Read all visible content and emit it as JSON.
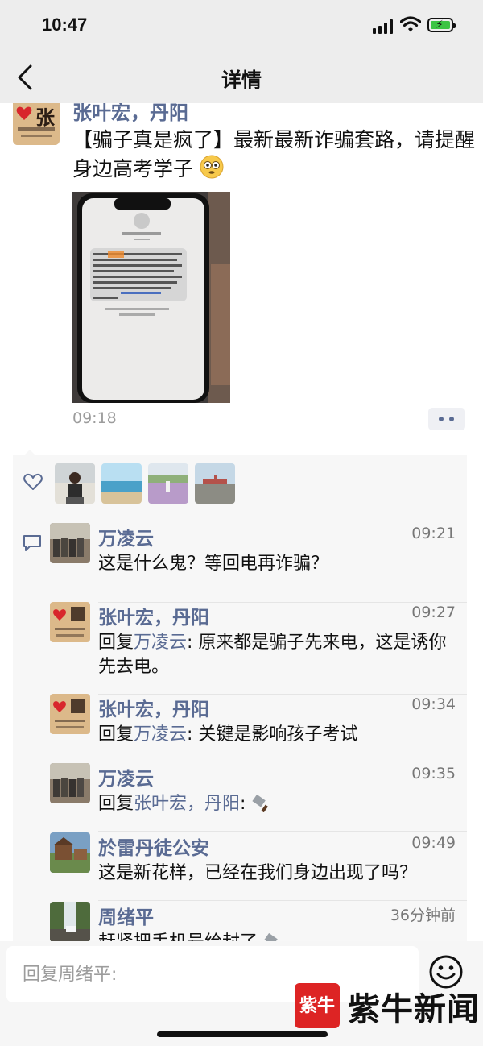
{
  "status": {
    "time": "10:47"
  },
  "nav": {
    "title": "详情"
  },
  "post": {
    "author": "张叶宏，丹阳",
    "avatar_seal_text": "张",
    "text": "【骗子真是疯了】最新最新诈骗套路，请提醒身边高考学子",
    "time": "09:18",
    "image_icon": "sms-screenshot-photo"
  },
  "likes": {
    "icon": "heart-icon",
    "avatars": [
      "man-portrait",
      "beach-scene",
      "flower-field",
      "runway-scene"
    ]
  },
  "comments": [
    {
      "name": "万凌云",
      "time": "09:21",
      "reply_prefix": "",
      "reply_to": "",
      "text": "这是什么鬼？等回电再诈骗？"
    },
    {
      "name": "张叶宏，丹阳",
      "time": "09:27",
      "reply_prefix": "回复",
      "reply_to": "万凌云",
      "text": ": 原来都是骗子先来电，这是诱你先去电。"
    },
    {
      "name": "张叶宏，丹阳",
      "time": "09:34",
      "reply_prefix": "回复",
      "reply_to": "万凌云",
      "text": ": 关键是影响孩子考试"
    },
    {
      "name": "万凌云",
      "time": "09:35",
      "reply_prefix": "回复",
      "reply_to": "张叶宏，丹阳",
      "text": ": "
    },
    {
      "name": "於雷丹徒公安",
      "time": "09:49",
      "reply_prefix": "",
      "reply_to": "",
      "text": "这是新花样，已经在我们身边出现了吗？"
    },
    {
      "name": "周绪平",
      "time": "36分钟前",
      "reply_prefix": "",
      "reply_to": "",
      "text": "赶紧把手机号给封了"
    }
  ],
  "input": {
    "placeholder": "回复周绪平:"
  },
  "watermark": {
    "logo": "紫牛",
    "text": "紫牛新闻"
  },
  "colors": {
    "name_blue": "#5a6b93",
    "nav_bg": "#ededed",
    "panel_bg": "#f7f7f7",
    "watermark_red": "#dd2424"
  }
}
